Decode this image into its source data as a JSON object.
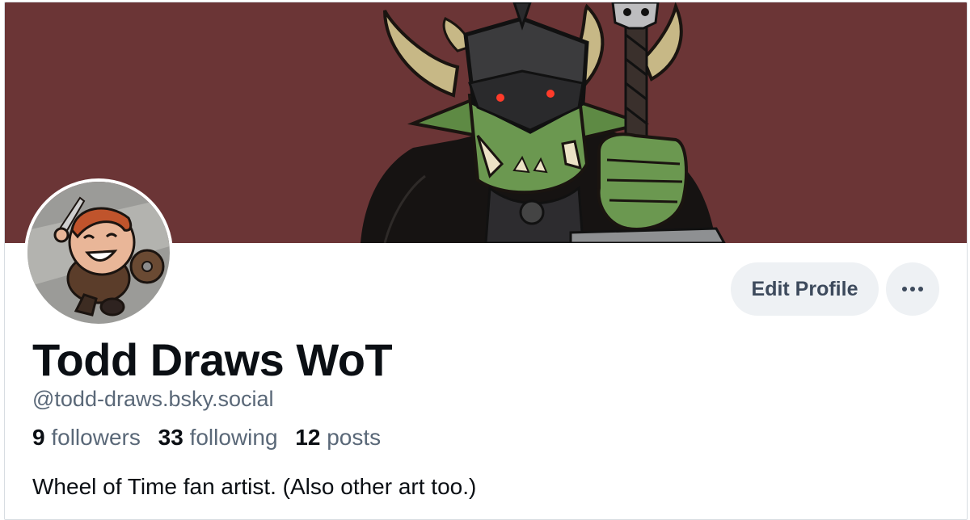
{
  "profile": {
    "display_name": "Todd Draws WoT",
    "handle": "@todd-draws.bsky.social",
    "bio": "Wheel of Time fan artist. (Also other art too.)"
  },
  "stats": {
    "followers_count": "9",
    "followers_label": "followers",
    "following_count": "33",
    "following_label": "following",
    "posts_count": "12",
    "posts_label": "posts"
  },
  "actions": {
    "edit_profile_label": "Edit Profile",
    "more_icon": "ellipsis-icon"
  },
  "banner": {
    "background_color": "#6b3536",
    "subject_icon": "orc-warrior-illustration"
  },
  "avatar": {
    "subject_icon": "cartoon-adventurer-illustration"
  },
  "colors": {
    "text_primary": "#0b0f14",
    "text_secondary": "#5a6878",
    "button_bg": "#eef1f4"
  }
}
